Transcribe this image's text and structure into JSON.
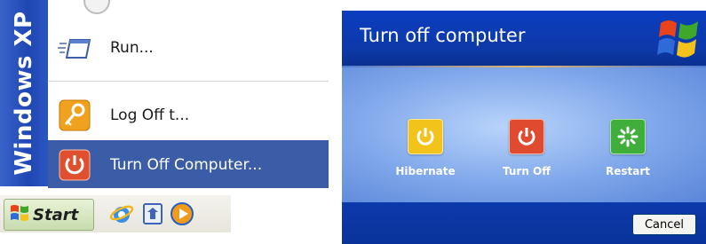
{
  "start_menu": {
    "sidebar_text": "Windows XP",
    "items": [
      {
        "label": "Run...",
        "icon": "run-icon"
      },
      {
        "label": "Log Off t...",
        "icon": "key-icon"
      },
      {
        "label": "Turn Off Computer...",
        "icon": "power-icon",
        "selected": true
      }
    ],
    "colors": {
      "sidebar": "#1f47b4",
      "selection": "#3b5ca7"
    }
  },
  "taskbar": {
    "start_label": "Start",
    "quick_launch": [
      "internet-explorer-icon",
      "outlook-express-icon",
      "media-player-icon"
    ]
  },
  "dialog": {
    "title": "Turn off computer",
    "options": [
      {
        "label": "Hibernate",
        "icon": "hibernate-icon",
        "color": "#f2c31a"
      },
      {
        "label": "Turn Off",
        "icon": "power-icon",
        "color": "#e04a2e"
      },
      {
        "label": "Restart",
        "icon": "restart-icon",
        "color": "#3fae3a"
      }
    ],
    "cancel_label": "Cancel",
    "colors": {
      "title_bar": "#0a3cc0",
      "body": "#7ea6ea"
    }
  }
}
